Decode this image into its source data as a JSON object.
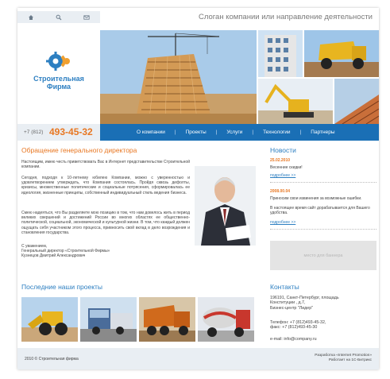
{
  "header": {
    "icons": [
      "home-icon",
      "search-icon",
      "mail-icon"
    ],
    "slogan": "Слоган компании или направление деятельности"
  },
  "logo": {
    "line1": "Строительная",
    "line2": "Фирма"
  },
  "phone": {
    "code": "+7 (812)",
    "number": "493-45-32"
  },
  "menu": [
    "О компании",
    "Проекты",
    "Услуги",
    "Технологии",
    "Партнеры"
  ],
  "director": {
    "title": "Обращение генерального директора",
    "p1": "Настоящим, имею честь приветствовать Вас в Интернет представительстве Строительной компании.",
    "p2": "Сегодня, подходя к 10-летнему юбилею Компании, можно с уверенностью и удовлетворением утверждать, что Компания состоялась. Пройдя сквозь дефолты, кризисы, множественные политические и социальные потрясения, сформировалась ее идеология, жизненные принципы, собственный индивидуальный стиль ведения бизнеса.",
    "p3": "Смею надеяться, что Вы разделяете мою позицию в том, что нам довелось жить в период великих свершений и достижений России во многих областях ее общественно-политической, социальной, экономической и культурной жизни. В том, что каждый должен ощущать себя участником этого процесса, привносить свой вклад в дело возрождения и становления государства.",
    "sign1": "С уважением,",
    "sign2": "Генеральный директор «Строительной Фирмы»",
    "sign3": "Кузнецов Дмитрий Александрович"
  },
  "projects": {
    "title": "Последние наши проекты"
  },
  "news": {
    "title": "Новости",
    "items": [
      {
        "date": "25.02.2010",
        "text": "Весенние скидки!",
        "link": "подробнее >>"
      },
      {
        "date": "2008.00.04",
        "text": "Приносим свои извинения за возможные ошибки.",
        "text2": "В настоящее время сайт дорабатывается для Вашего удобства.",
        "link": "подробнее >>"
      }
    ]
  },
  "banner": {
    "label": "место для баннера"
  },
  "contacts": {
    "title": "Контакты",
    "address1": "196191, Санкт-Петербург, площадь",
    "address2": "Конституции , д.7,",
    "address3": "Бизнес-центр \"Лидер\"",
    "phone": "Телефон: +7 (812)493-45-32,",
    "fax": "факс: +7 (812)493-45-30",
    "email": "e-mail: info@company.ru"
  },
  "footer": {
    "copyright": "2010 © Строительная фирма",
    "dev1": "Разработка «Internet Promotion»",
    "dev2": "Работает на 1С-Битрикс"
  },
  "colors": {
    "accent": "#e87722",
    "brand": "#1a6fb5",
    "link": "#2d7fc1"
  }
}
